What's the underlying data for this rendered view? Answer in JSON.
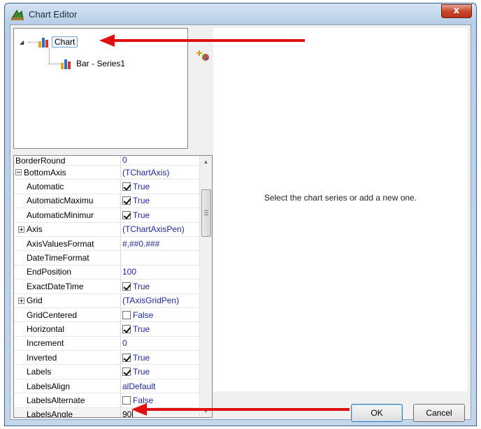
{
  "window": {
    "title": "Chart Editor",
    "close_label": "x"
  },
  "tree": {
    "root_label": "Chart",
    "child_label": "Bar - Series1"
  },
  "right_panel": {
    "message": "Select the chart series or add a new one."
  },
  "inspector": {
    "rows": [
      {
        "name": "BorderRound",
        "value": "0"
      },
      {
        "name": "BottomAxis",
        "value": "(TChartAxis)"
      },
      {
        "name": "Automatic",
        "value": "True"
      },
      {
        "name": "AutomaticMaximu",
        "value": "True"
      },
      {
        "name": "AutomaticMinimur",
        "value": "True"
      },
      {
        "name": "Axis",
        "value": "(TChartAxisPen)"
      },
      {
        "name": "AxisValuesFormat",
        "value": "#,##0.###"
      },
      {
        "name": "DateTimeFormat",
        "value": ""
      },
      {
        "name": "EndPosition",
        "value": "100"
      },
      {
        "name": "ExactDateTime",
        "value": "True"
      },
      {
        "name": "Grid",
        "value": "(TAxisGridPen)"
      },
      {
        "name": "GridCentered",
        "value": "False"
      },
      {
        "name": "Horizontal",
        "value": "True"
      },
      {
        "name": "Increment",
        "value": "0"
      },
      {
        "name": "Inverted",
        "value": "True"
      },
      {
        "name": "Labels",
        "value": "True"
      },
      {
        "name": "LabelsAlign",
        "value": "alDefault"
      },
      {
        "name": "LabelsAlternate",
        "value": "False"
      },
      {
        "name": "LabelsAngle",
        "value": "90"
      }
    ]
  },
  "buttons": {
    "ok": "OK",
    "cancel": "Cancel"
  },
  "colors": {
    "annotation_arrow": "#e01010",
    "value_text": "#1d2a9e"
  }
}
